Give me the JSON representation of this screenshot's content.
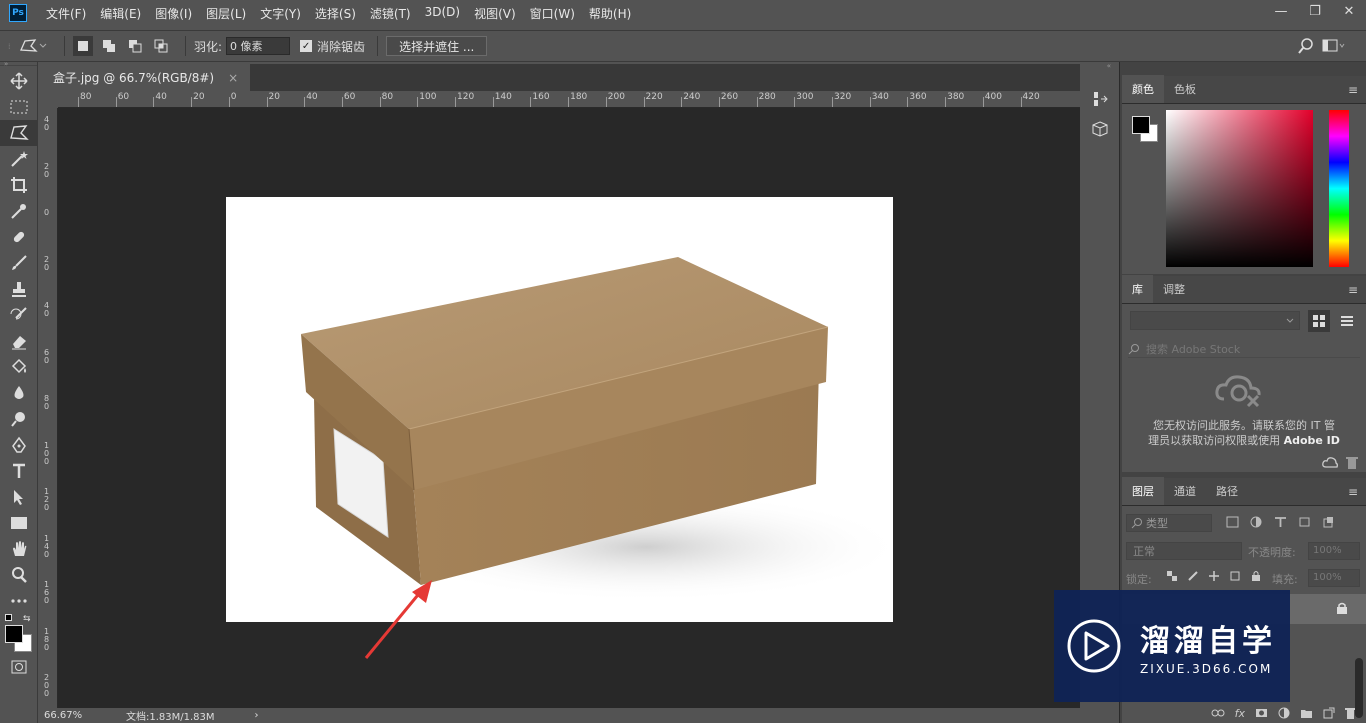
{
  "app": {
    "logo": "Ps"
  },
  "menu": [
    "文件(F)",
    "编辑(E)",
    "图像(I)",
    "图层(L)",
    "文字(Y)",
    "选择(S)",
    "滤镜(T)",
    "3D(D)",
    "视图(V)",
    "窗口(W)",
    "帮助(H)"
  ],
  "window_controls": {
    "minimize": "—",
    "restore": "❐",
    "close": "✕"
  },
  "options": {
    "feather_label": "羽化:",
    "feather_value": "0 像素",
    "antialias_checked": "✓",
    "antialias_label": "消除锯齿",
    "select_mask_label": "选择并遮住 ..."
  },
  "document": {
    "tab_title": "盒子.jpg @ 66.7%(RGB/8#)",
    "tab_close": "×",
    "hruler_ticks": [
      "80",
      "60",
      "40",
      "20",
      "0",
      "20",
      "40",
      "60",
      "80",
      "100",
      "120",
      "140",
      "160",
      "180",
      "200",
      "220",
      "240",
      "260",
      "280",
      "300",
      "320",
      "340",
      "360",
      "380",
      "400",
      "420"
    ],
    "vruler_ticks": [
      "4 0",
      "2 0",
      "0",
      "2 0",
      "4 0",
      "6 0",
      "8 0",
      "1 0 0",
      "1 2 0",
      "1 4 0",
      "1 6 0",
      "1 8 0",
      "2 0 0"
    ],
    "zoom": "66.67%",
    "doc_info": "文档:1.83M/1.83M",
    "status_arrow": "›"
  },
  "panels": {
    "color": {
      "tabs": [
        "颜色",
        "色板"
      ]
    },
    "library": {
      "tabs": [
        "库",
        "调整"
      ],
      "search_placeholder": "搜索 Adobe Stock",
      "message_line1": "您无权访问此服务。请联系您的 IT 管",
      "message_line2": "理员以获取访问权限或使用",
      "message_bold": "Adobe ID"
    },
    "layers": {
      "tabs": [
        "图层",
        "通道",
        "路径"
      ],
      "filter_label": "类型",
      "blend_mode": "正常",
      "opacity_label": "不透明度:",
      "opacity_value": "100%",
      "lock_label": "锁定:",
      "fill_label": "填充:",
      "fill_value": "100%"
    },
    "menu_icon": "≡"
  },
  "watermark": {
    "title": "溜溜自学",
    "url": "ZIXUE.3D66.COM"
  },
  "colors": {
    "ui_bg": "#535353",
    "canvas_bg": "#282828",
    "box_light": "#b89770",
    "box_dark": "#9a7a55",
    "arrow": "#e53935",
    "watermark_bg": "#0f2355"
  }
}
